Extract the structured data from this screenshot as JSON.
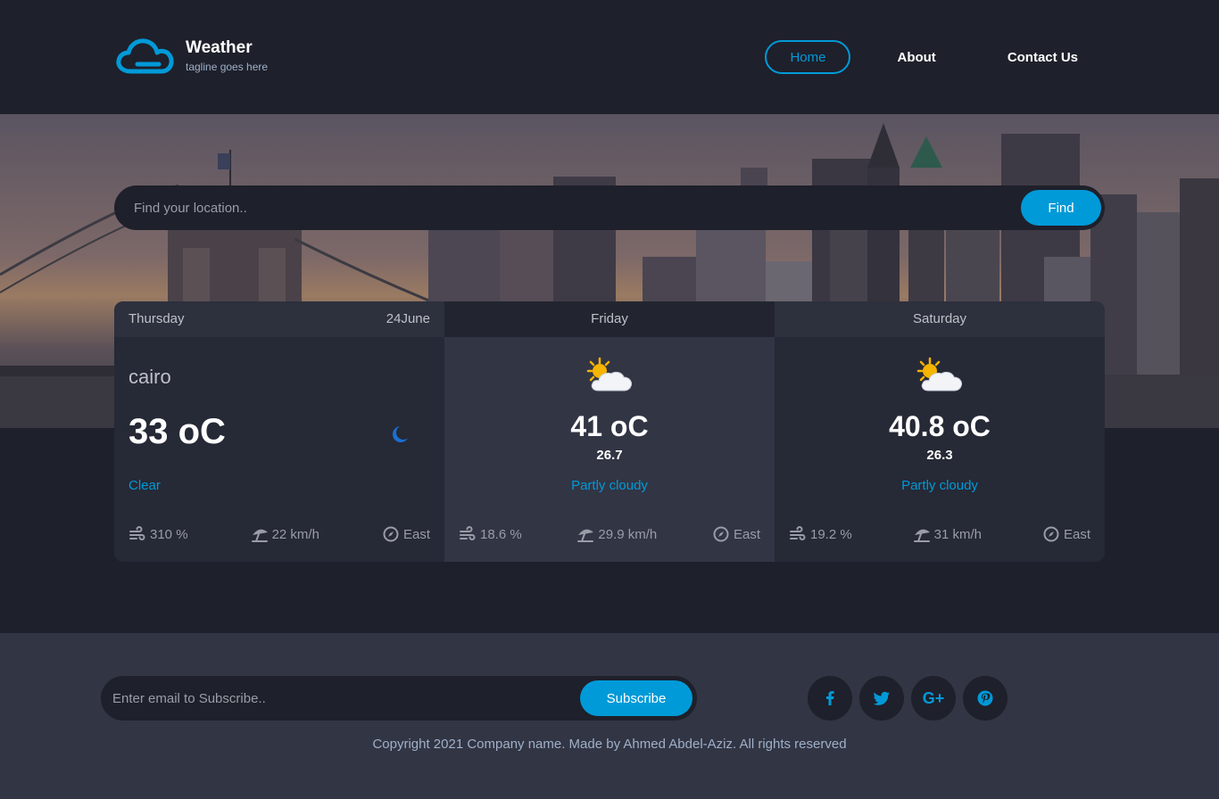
{
  "brand": {
    "title": "Weather",
    "tagline": "tagline goes here",
    "accent": "#009ad8"
  },
  "nav": {
    "items": [
      {
        "label": "Home",
        "active": true
      },
      {
        "label": "About"
      },
      {
        "label": "Contact Us"
      }
    ]
  },
  "search": {
    "placeholder": "Find your location..",
    "button": "Find"
  },
  "forecast": {
    "today": {
      "day": "Thursday",
      "date": "24June",
      "city": "cairo",
      "temp": "33 oC",
      "icon": "moon-icon",
      "condition": "Clear",
      "humidity": "310 %",
      "wind": "22 km/h",
      "direction": "East"
    },
    "days": [
      {
        "day": "Friday",
        "icon": "partly-cloudy-icon",
        "max": "41 oC",
        "min": "26.7",
        "condition": "Partly cloudy",
        "humidity": "18.6 %",
        "wind": "29.9 km/h",
        "direction": "East"
      },
      {
        "day": "Saturday",
        "icon": "partly-cloudy-icon",
        "max": "40.8 oC",
        "min": "26.3",
        "condition": "Partly cloudy",
        "humidity": "19.2 %",
        "wind": "31 km/h",
        "direction": "East"
      }
    ]
  },
  "footer": {
    "subscribe_placeholder": "Enter email to Subscribe..",
    "subscribe_button": "Subscribe",
    "social": [
      "facebook-icon",
      "twitter-icon",
      "google-plus-icon",
      "pinterest-icon"
    ],
    "google_plus_label": "G+",
    "copyright": "Copyright 2021 Company name. Made by Ahmed Abdel-Aziz. All rights reserved"
  }
}
